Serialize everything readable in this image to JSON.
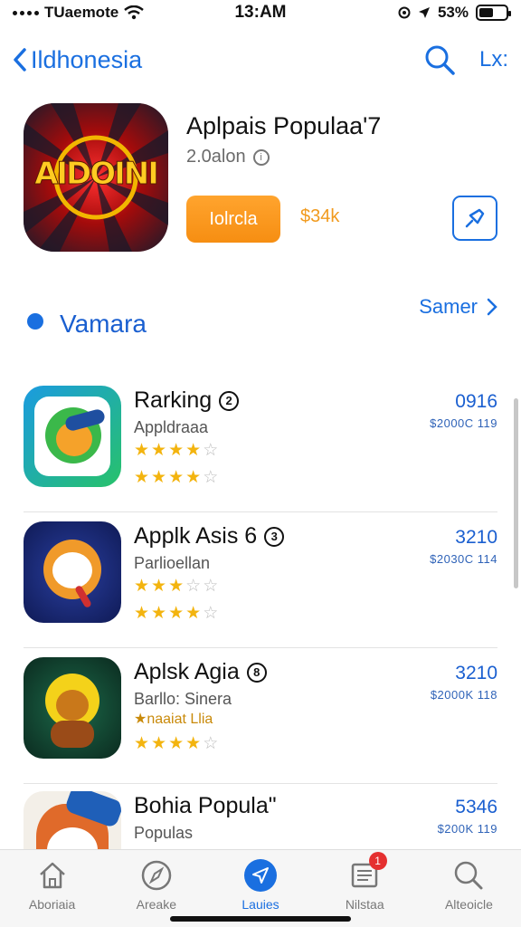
{
  "status_bar": {
    "carrier": "TUaemote",
    "time": "13:AM",
    "battery": "53%",
    "battery_level": 0.53
  },
  "nav": {
    "back_label": "Ildhonesia",
    "action_label": "Lx:",
    "icons": [
      "chevron-left-icon",
      "search-icon"
    ]
  },
  "featured": {
    "title": "Aplpais Populaa'7",
    "subtitle": "2.0alon",
    "info_mark": "i",
    "icon_text": "AIDOINI",
    "get_label": "Iolrcla",
    "count": "34k",
    "accent_color": "#f68e12"
  },
  "section": {
    "title": "Vamara",
    "see_all": "Samer"
  },
  "apps": [
    {
      "name": "Rarking",
      "badge": "2",
      "sub": "Appldraaa",
      "sub2": "",
      "price": "0916",
      "size": "$2000C 119",
      "stars1": 4,
      "stars2": 4
    },
    {
      "name": "Applk Asis 6",
      "badge": "3",
      "sub": "Parlioellan",
      "sub2": "",
      "price": "3210",
      "size": "$2030C 114",
      "stars1": 3,
      "stars2": 4
    },
    {
      "name": "Aplsk Agia",
      "badge": "8",
      "sub": "Barllo: Sinera",
      "sub2": "★naaiat Llia",
      "price": "3210",
      "size": "$2000K 118",
      "stars1": null,
      "stars2": 4
    },
    {
      "name": "Bohia Popula\"",
      "badge": "",
      "sub": "Populas",
      "sub2": "",
      "price": "5346",
      "size": "$200K 119",
      "stars1": null,
      "stars2": null
    }
  ],
  "tabs": [
    {
      "label": "Aboriaia",
      "icon": "home-icon"
    },
    {
      "label": "Areake",
      "icon": "compass-icon"
    },
    {
      "label": "Lauies",
      "icon": "paper-plane-icon"
    },
    {
      "label": "Nilstaa",
      "icon": "news-icon",
      "badge": "1"
    },
    {
      "label": "Alteoicle",
      "icon": "search-icon"
    }
  ]
}
